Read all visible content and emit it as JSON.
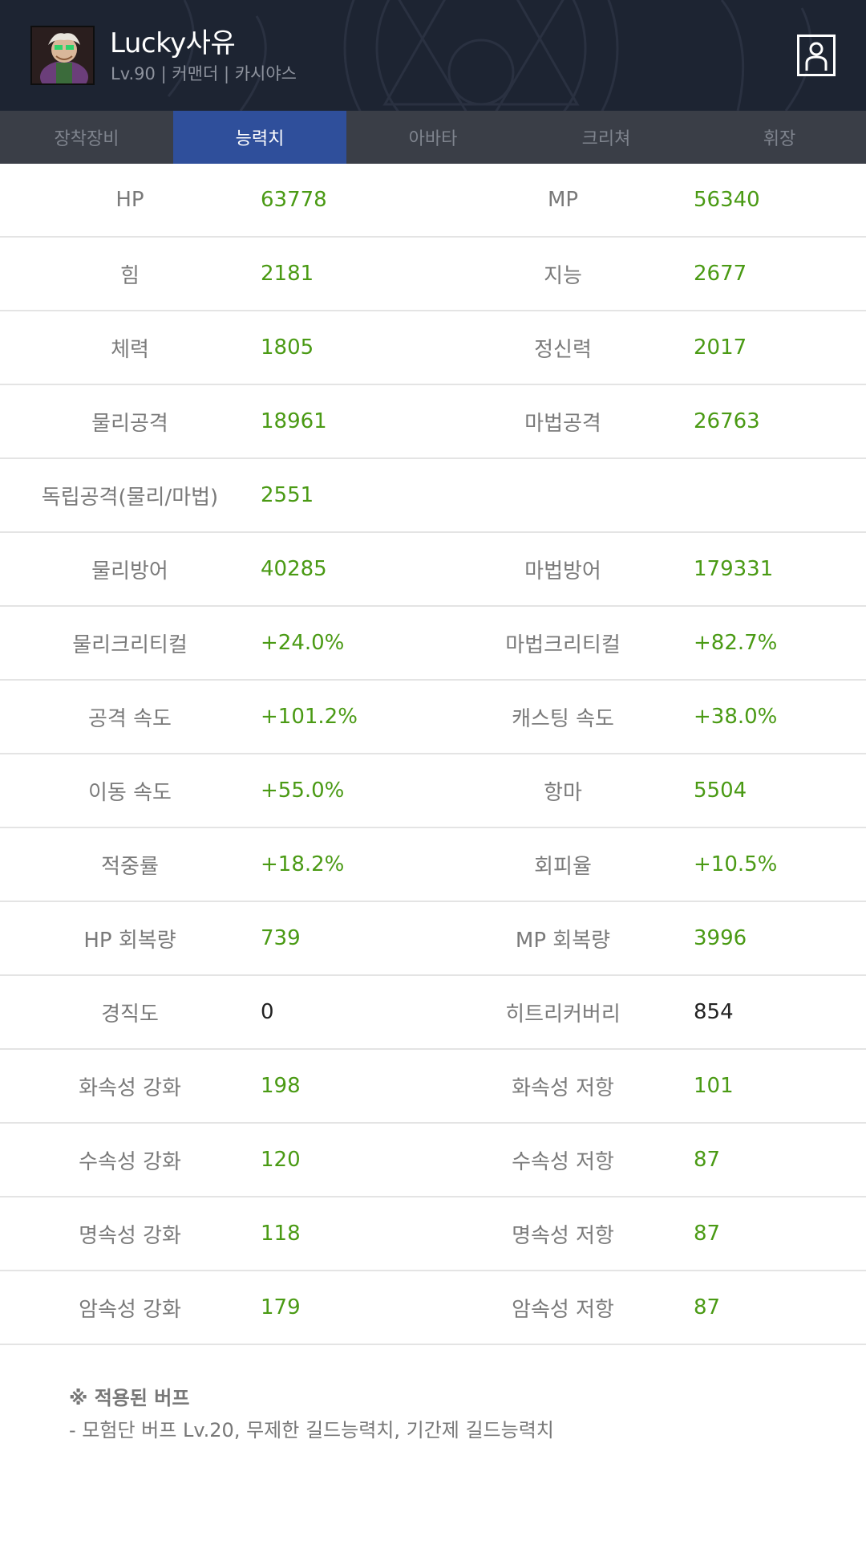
{
  "header": {
    "character_name": "Lucky사유",
    "character_info": "Lv.90 | 커맨더 | 카시야스",
    "profile_icon": "user-profile-icon"
  },
  "tabs": [
    {
      "label": "장착장비",
      "active": false
    },
    {
      "label": "능력치",
      "active": true
    },
    {
      "label": "아바타",
      "active": false
    },
    {
      "label": "크리쳐",
      "active": false
    },
    {
      "label": "휘장",
      "active": false
    }
  ],
  "stats": [
    {
      "left_label": "HP",
      "left_value": "63778",
      "right_label": "MP",
      "right_value": "56340"
    },
    {
      "left_label": "힘",
      "left_value": "2181",
      "right_label": "지능",
      "right_value": "2677"
    },
    {
      "left_label": "체력",
      "left_value": "1805",
      "right_label": "정신력",
      "right_value": "2017"
    },
    {
      "left_label": "물리공격",
      "left_value": "18961",
      "right_label": "마법공격",
      "right_value": "26763"
    },
    {
      "left_label": "독립공격(물리/마법)",
      "left_value": "2551",
      "right_label": "",
      "right_value": ""
    },
    {
      "left_label": "물리방어",
      "left_value": "40285",
      "right_label": "마법방어",
      "right_value": "179331"
    },
    {
      "left_label": "물리크리티컬",
      "left_value": "+24.0%",
      "right_label": "마법크리티컬",
      "right_value": "+82.7%"
    },
    {
      "left_label": "공격 속도",
      "left_value": "+101.2%",
      "right_label": "캐스팅 속도",
      "right_value": "+38.0%"
    },
    {
      "left_label": "이동 속도",
      "left_value": "+55.0%",
      "right_label": "항마",
      "right_value": "5504"
    },
    {
      "left_label": "적중률",
      "left_value": "+18.2%",
      "right_label": "회피율",
      "right_value": "+10.5%"
    },
    {
      "left_label": "HP 회복량",
      "left_value": "739",
      "right_label": "MP 회복량",
      "right_value": "3996"
    },
    {
      "left_label": "경직도",
      "left_value": "0",
      "right_label": "히트리커버리",
      "right_value": "854"
    },
    {
      "left_label": "화속성 강화",
      "left_value": "198",
      "right_label": "화속성 저항",
      "right_value": "101"
    },
    {
      "left_label": "수속성 강화",
      "left_value": "120",
      "right_label": "수속성 저항",
      "right_value": "87"
    },
    {
      "left_label": "명속성 강화",
      "left_value": "118",
      "right_label": "명속성 저항",
      "right_value": "87"
    },
    {
      "left_label": "암속성 강화",
      "left_value": "179",
      "right_label": "암속성 저항",
      "right_value": "87"
    }
  ],
  "buff": {
    "title": "※ 적용된 버프",
    "text": "- 모험단 버프 Lv.20, 무제한 길드능력치, 기간제 길드능력치"
  },
  "colors": {
    "header_bg": "#1d2432",
    "tab_bg": "#3a3e47",
    "tab_active": "#2f4f9b",
    "value_green": "#4a9a14",
    "value_plain": "#222222",
    "label_gray": "#7a7a7a"
  }
}
